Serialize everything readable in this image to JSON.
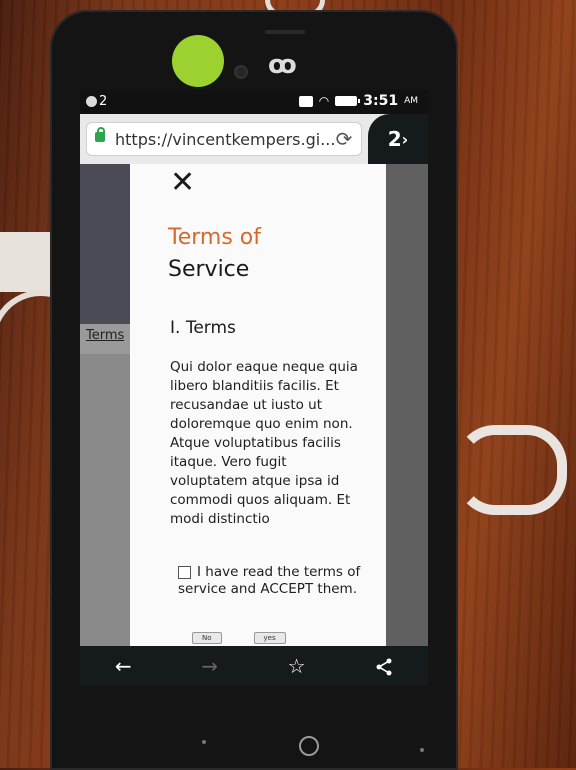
{
  "status_bar": {
    "notification_count": "2",
    "time": "3:51",
    "ampm": "AM"
  },
  "browser": {
    "url": "https://vincentkempers.gi...",
    "tab_count": "2"
  },
  "background_page": {
    "link_text": "Terms"
  },
  "modal": {
    "title_line1": "Terms of",
    "title_line2": "Service",
    "section_heading": "I. Terms",
    "body": "Qui dolor eaque neque quia libero blanditiis facilis. Et recusandae ut iusto ut doloremque quo enim non. Atque voluptatibus facilis itaque. Vero fugit voluptatem atque ipsa id commodi quos aliquam. Et modi distinctio",
    "consent_label": "I have read the terms of service and ACCEPT them.",
    "no_label": "No",
    "yes_label": "yes"
  },
  "colors": {
    "title_accent": "#d56a28",
    "lock": "#2ea44f",
    "sensor": "#9bd22f"
  },
  "icons": {
    "close": "close-icon",
    "reload": "reload-icon",
    "back": "back-arrow-icon",
    "forward": "forward-arrow-icon",
    "bookmark": "star-icon",
    "share": "share-icon"
  }
}
